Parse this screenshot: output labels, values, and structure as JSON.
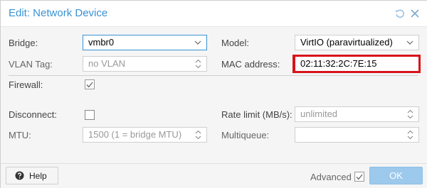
{
  "window": {
    "title": "Edit: Network Device"
  },
  "form": {
    "bridge": {
      "label": "Bridge:",
      "value": "vmbr0"
    },
    "vlan_tag": {
      "label": "VLAN Tag:",
      "placeholder": "no VLAN"
    },
    "firewall": {
      "label": "Firewall:",
      "checked": true
    },
    "model": {
      "label": "Model:",
      "value": "VirtIO (paravirtualized)"
    },
    "mac_address": {
      "label": "MAC address:",
      "value": "02:11:32:2C:7E:15"
    },
    "disconnect": {
      "label": "Disconnect:",
      "checked": false
    },
    "mtu": {
      "label": "MTU:",
      "placeholder": "1500 (1 = bridge MTU)"
    },
    "rate_limit": {
      "label": "Rate limit (MB/s):",
      "placeholder": "unlimited"
    },
    "multiqueue": {
      "label": "Multiqueue:",
      "value": ""
    }
  },
  "footer": {
    "help_label": "Help",
    "advanced_label": "Advanced",
    "advanced_checked": true,
    "ok_label": "OK"
  },
  "colors": {
    "accent": "#3892d4",
    "highlight": "#d8131a",
    "ok_disabled": "#9dc9ec"
  }
}
